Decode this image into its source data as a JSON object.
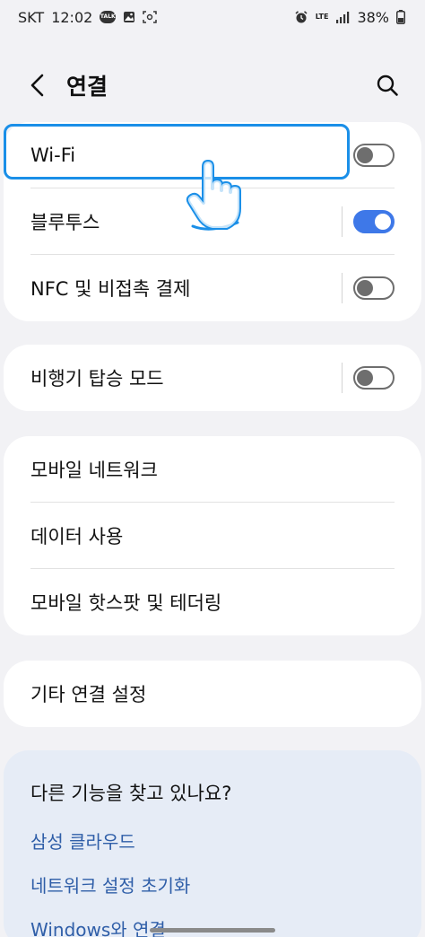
{
  "status_bar": {
    "carrier": "SKT",
    "time": "12:02",
    "talk_label": "TALK",
    "network": "LTE",
    "battery": "38%",
    "icons": [
      "talk-icon",
      "gallery-icon",
      "screenshot-icon",
      "alarm-icon",
      "lte-icon",
      "signal-icon",
      "battery-icon"
    ]
  },
  "header": {
    "title": "연결",
    "back_icon": "back-arrow-icon",
    "search_icon": "search-icon"
  },
  "group1": [
    {
      "label": "Wi-Fi",
      "toggle": false,
      "highlighted": true
    },
    {
      "label": "블루투스",
      "toggle": true
    },
    {
      "label": "NFC 및 비접촉 결제",
      "toggle": false
    }
  ],
  "group2": [
    {
      "label": "비행기 탑승 모드",
      "toggle": false
    }
  ],
  "group3": [
    {
      "label": "모바일 네트워크"
    },
    {
      "label": "데이터 사용"
    },
    {
      "label": "모바일 핫스팟 및 테더링"
    }
  ],
  "group4": [
    {
      "label": "기타 연결 설정"
    }
  ],
  "suggestions": {
    "title": "다른 기능을 찾고 있나요?",
    "links": [
      "삼성 클라우드",
      "네트워크 설정 초기화",
      "Windows와 연결"
    ]
  },
  "colors": {
    "accent": "#3e78e8",
    "highlight": "#1a8fe8",
    "link": "#2f5ea8",
    "background": "#f2f2f5"
  }
}
